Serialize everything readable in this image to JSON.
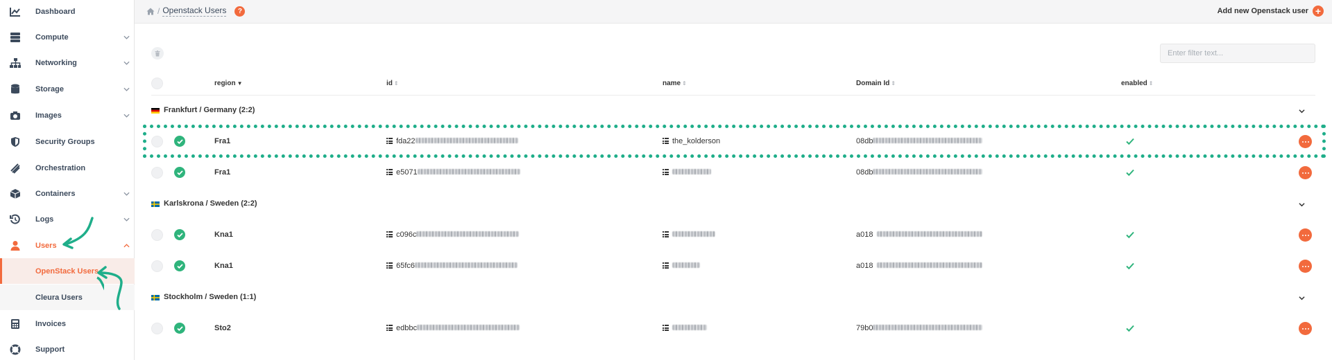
{
  "sidebar": {
    "items": [
      {
        "label": "Dashboard",
        "icon": "chart-icon"
      },
      {
        "label": "Compute",
        "icon": "server-icon"
      },
      {
        "label": "Networking",
        "icon": "network-icon"
      },
      {
        "label": "Storage",
        "icon": "database-icon"
      },
      {
        "label": "Images",
        "icon": "camera-icon"
      },
      {
        "label": "Security Groups",
        "icon": "shield-icon"
      },
      {
        "label": "Orchestration",
        "icon": "layers-icon"
      },
      {
        "label": "Containers",
        "icon": "box-icon"
      },
      {
        "label": "Logs",
        "icon": "history-icon"
      },
      {
        "label": "Users",
        "icon": "user-icon"
      },
      {
        "label": "Invoices",
        "icon": "calculator-icon"
      },
      {
        "label": "Support",
        "icon": "lifebuoy-icon"
      }
    ],
    "subitems": [
      {
        "label": "OpenStack Users"
      },
      {
        "label": "Cleura Users"
      }
    ]
  },
  "header": {
    "breadcrumb_sep": "/",
    "title": "Openstack Users",
    "help": "?",
    "add_label": "Add new Openstack user"
  },
  "filter": {
    "placeholder": "Enter filter text..."
  },
  "table": {
    "columns": [
      "region",
      "id",
      "name",
      "Domain Id",
      "enabled"
    ],
    "groups": [
      {
        "label": "Frankfurt / Germany (2:2)",
        "flag": "germany"
      },
      {
        "label": "Karlskrona / Sweden (2:2)",
        "flag": "sweden"
      },
      {
        "label": "Stockholm / Sweden (1:1)",
        "flag": "sweden"
      }
    ],
    "rows": [
      {
        "region": "Fra1",
        "id_prefix": "fda22",
        "name": "the_kolderson",
        "domain_prefix": "08db"
      },
      {
        "region": "Fra1",
        "id_prefix": "e5071",
        "name": "",
        "domain_prefix": "08db"
      },
      {
        "region": "Kna1",
        "id_prefix": "c096c",
        "name": "",
        "domain_prefix": "a018"
      },
      {
        "region": "Kna1",
        "id_prefix": "65fc6",
        "name": "",
        "domain_prefix": "a018"
      },
      {
        "region": "Sto2",
        "id_prefix": "edbbc",
        "name": "",
        "domain_prefix": "79b0"
      }
    ]
  },
  "colors": {
    "accent": "#f26a3d",
    "success": "#2fb47c",
    "annotation": "#1fae8a"
  }
}
